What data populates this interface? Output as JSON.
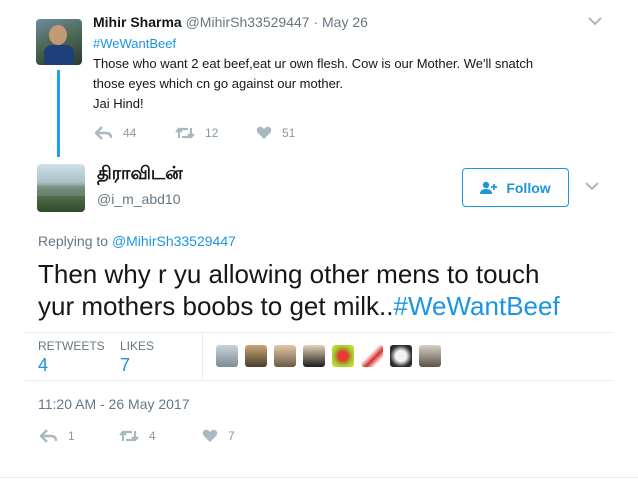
{
  "parent_tweet": {
    "display_name": "Mihir Sharma",
    "handle": "@MihirSh33529447",
    "separator": "·",
    "date": "May 26",
    "hashtag": "#WeWantBeef",
    "text_line1": "Those who want 2 eat beef,eat ur own flesh. Cow is our Mother. We'll snatch",
    "text_line2": "those eyes which cn go against our mother.",
    "text_line3": "Jai Hind!",
    "replies": "44",
    "retweets": "12",
    "likes": "51"
  },
  "main_tweet": {
    "display_name": "திராவிடன்",
    "handle": "@i_m_abd10",
    "follow_label": "Follow",
    "replying_prefix": "Replying to",
    "replying_to": "@MihirSh33529447",
    "text_line1": "Then why r yu allowing other mens to touch",
    "text_line2": "yur mothers boobs to get milk..",
    "hashtag": "#WeWantBeef",
    "stats": {
      "retweets_label": "RETWEETS",
      "retweets_value": "4",
      "likes_label": "LIKES",
      "likes_value": "7"
    },
    "timestamp": "11:20 AM - 26 May 2017",
    "actions": {
      "replies": "1",
      "retweets": "4",
      "likes": "7"
    }
  },
  "colors": {
    "link": "#1b95e0",
    "muted": "#657786",
    "action": "#8899a6",
    "thread_line": "#1da1f2"
  },
  "icons": [
    "chevron-down-icon",
    "reply-icon",
    "retweet-icon",
    "heart-icon",
    "follow-user-icon"
  ]
}
